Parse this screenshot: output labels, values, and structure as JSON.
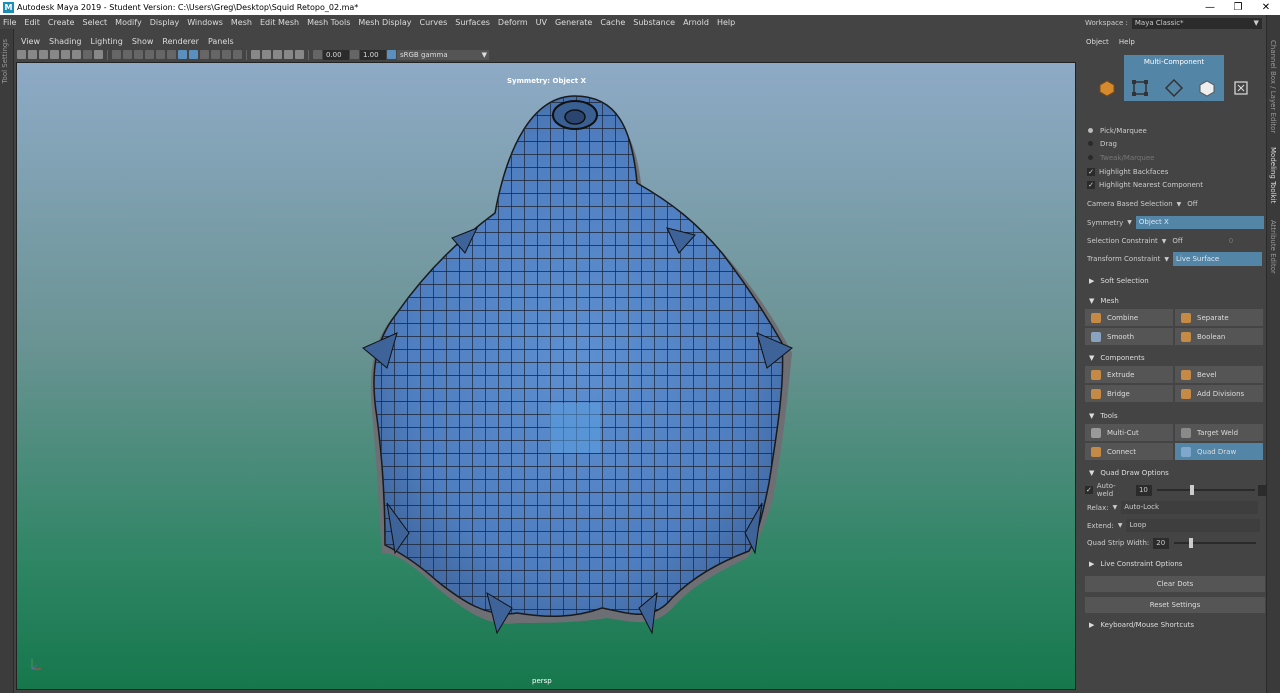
{
  "window": {
    "title": "Autodesk Maya 2019 - Student Version: C:\\Users\\Greg\\Desktop\\Squid Retopo_02.ma*",
    "controls": [
      "—",
      "❐",
      "✕"
    ]
  },
  "menubar": [
    "File",
    "Edit",
    "Create",
    "Select",
    "Modify",
    "Display",
    "Windows",
    "Mesh",
    "Edit Mesh",
    "Mesh Tools",
    "Mesh Display",
    "Curves",
    "Surfaces",
    "Deform",
    "UV",
    "Generate",
    "Cache",
    "Substance",
    "Arnold",
    "Help"
  ],
  "left_strip_label": "Tool Settings",
  "viewport": {
    "menu": [
      "View",
      "Shading",
      "Lighting",
      "Show",
      "Renderer",
      "Panels"
    ],
    "toolbar": {
      "value1": "0.00",
      "value2": "1.00",
      "color_space": "sRGB gamma"
    },
    "symmetry_label": "Symmetry: Object X",
    "camera_label": "persp"
  },
  "right_panel": {
    "workspace_label": "Workspace :",
    "workspace_value": "Maya Classic*",
    "menu": [
      "Object",
      "Help"
    ],
    "multi_component": "Multi-Component",
    "selection_modes": [
      {
        "label": "Pick/Marquee",
        "active": true
      },
      {
        "label": "Drag",
        "active": false
      },
      {
        "label": "Tweak/Marquee",
        "active": false
      }
    ],
    "checks": [
      {
        "label": "Highlight Backfaces",
        "checked": true
      },
      {
        "label": "Highlight Nearest Component",
        "checked": true
      }
    ],
    "camera_based_selection": {
      "label": "Camera Based Selection",
      "value": "Off"
    },
    "symmetry": {
      "label": "Symmetry",
      "value": "Object X"
    },
    "selection_constraint": {
      "label": "Selection Constraint",
      "value": "Off",
      "extra": "0"
    },
    "transform_constraint": {
      "label": "Transform Constraint",
      "value": "Live Surface"
    },
    "soft_selection": "Soft Selection",
    "sections": {
      "mesh": "Mesh",
      "components": "Components",
      "tools": "Tools"
    },
    "mesh_buttons": [
      "Combine",
      "Separate",
      "Smooth",
      "Boolean"
    ],
    "component_buttons": [
      "Extrude",
      "Bevel",
      "Bridge",
      "Add Divisions"
    ],
    "tool_buttons": [
      "Multi-Cut",
      "Target Weld",
      "Connect",
      "Quad Draw"
    ],
    "quad_draw_options": {
      "title": "Quad Draw Options",
      "auto_weld": {
        "label": "Auto-weld",
        "value": "10",
        "checked": true
      },
      "relax": {
        "label": "Relax:",
        "value": "Auto-Lock"
      },
      "extend": {
        "label": "Extend:",
        "value": "Loop"
      },
      "strip_width": {
        "label": "Quad Strip Width:",
        "value": "20"
      }
    },
    "live_constraint_options": "Live Constraint Options",
    "clear_dots": "Clear Dots",
    "reset_settings": "Reset Settings",
    "keyboard_shortcuts": "Keyboard/Mouse Shortcuts"
  },
  "side_tabs": [
    "Channel Box / Layer Editor",
    "Modeling Toolkit",
    "Attribute Editor"
  ],
  "colors": {
    "accent_blue": "#5285a6",
    "panel_bg": "#444444",
    "mesh_blue": "#4f7ec0",
    "icon_orange": "#c58a45"
  }
}
